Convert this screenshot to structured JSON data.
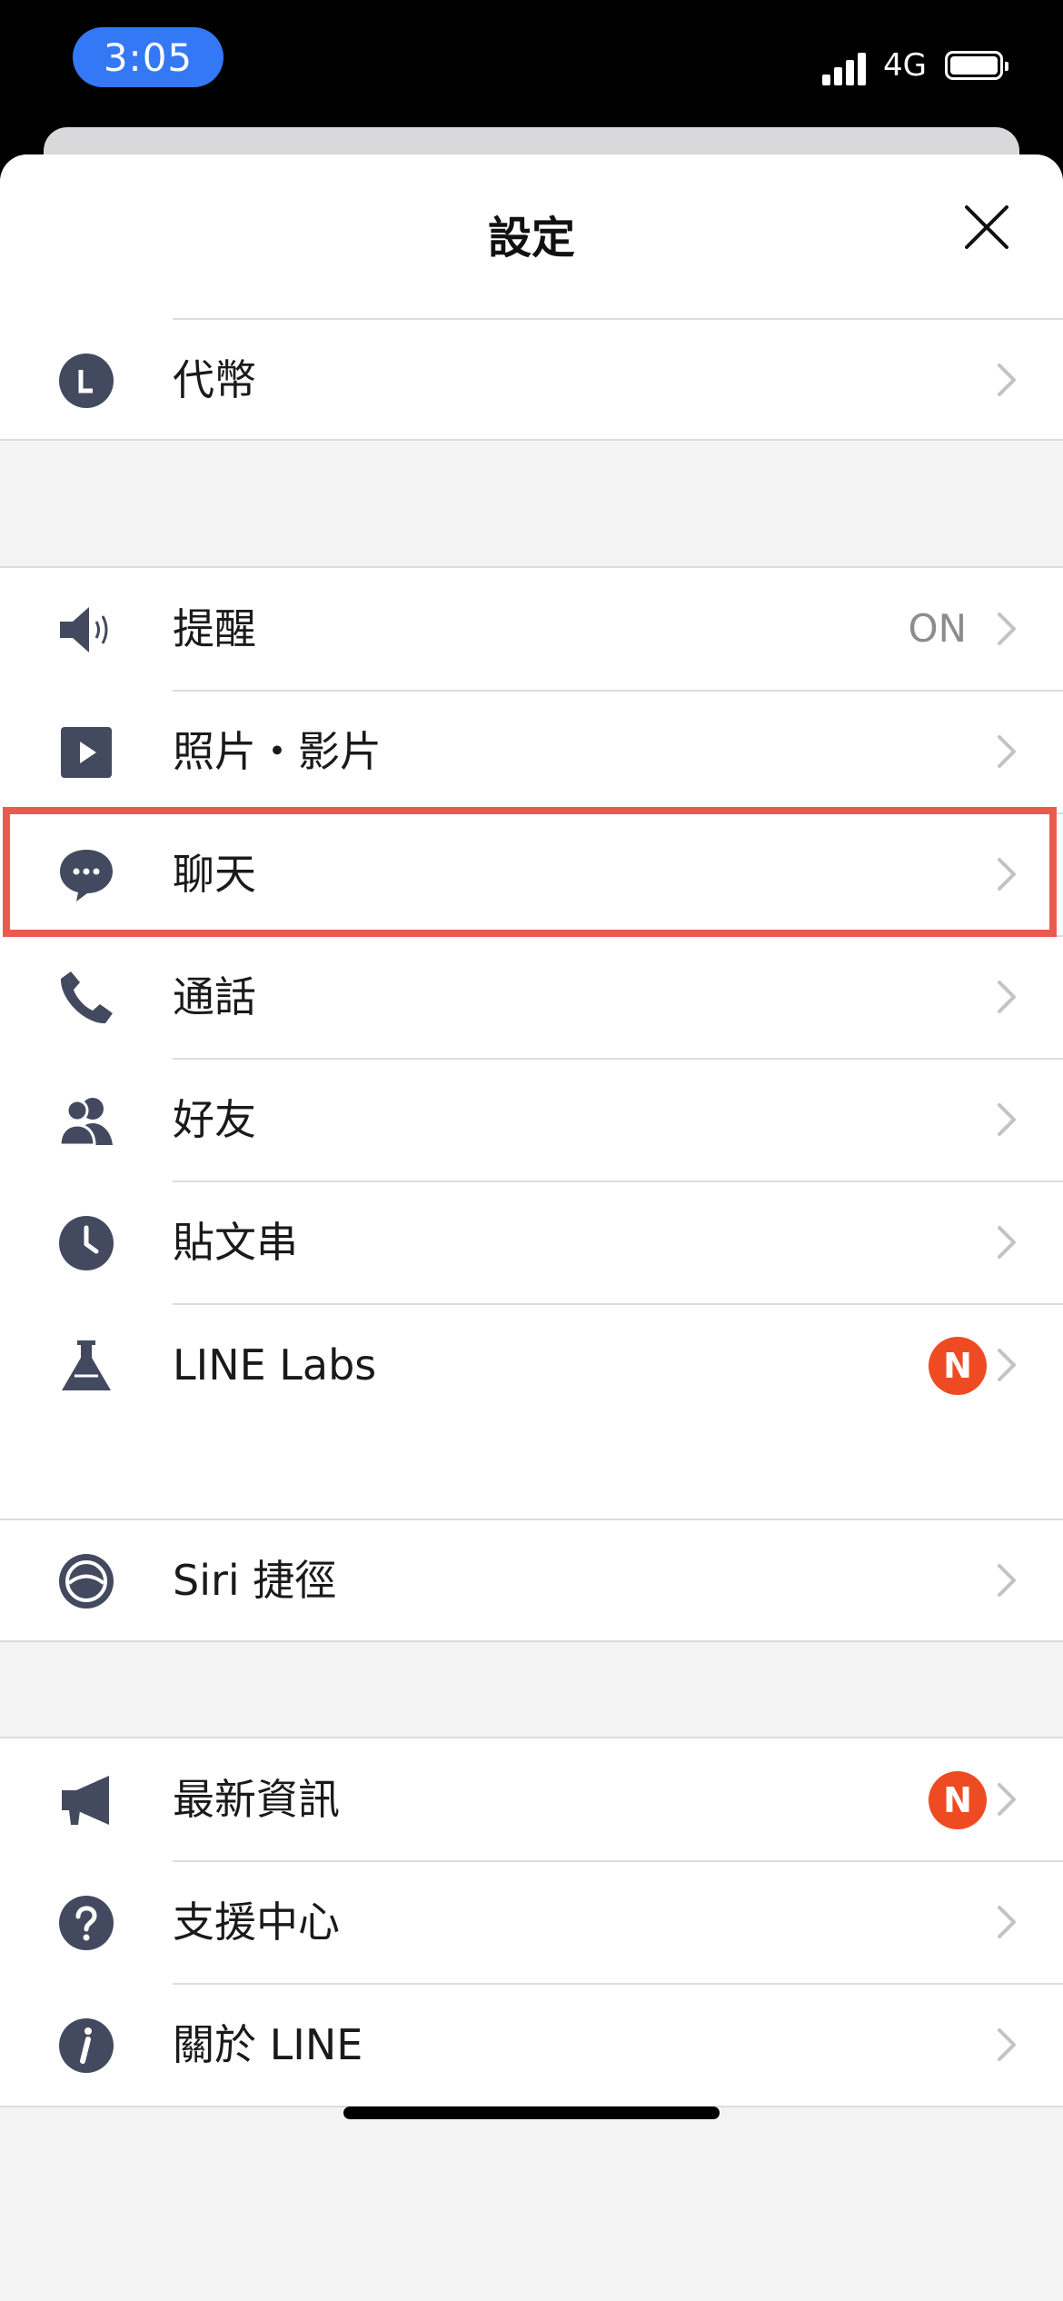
{
  "status_bar": {
    "time": "3:05",
    "network": "4G"
  },
  "sheet": {
    "title": "設定"
  },
  "sections": {
    "top": [
      {
        "label": "代幣",
        "icon": "line-coin-icon"
      }
    ],
    "main": [
      {
        "label": "提醒",
        "icon": "speaker-icon",
        "value": "ON"
      },
      {
        "label": "照片・影片",
        "icon": "play-icon"
      },
      {
        "label": "聊天",
        "icon": "chat-bubble-icon"
      },
      {
        "label": "通話",
        "icon": "phone-icon"
      },
      {
        "label": "好友",
        "icon": "friends-icon"
      },
      {
        "label": "貼文串",
        "icon": "clock-icon"
      },
      {
        "label": "LINE Labs",
        "icon": "flask-icon",
        "badge": "N"
      }
    ],
    "siri": [
      {
        "label": "Siri 捷徑",
        "icon": "siri-icon"
      }
    ],
    "info": [
      {
        "label": "最新資訊",
        "icon": "megaphone-icon",
        "badge": "N"
      },
      {
        "label": "支援中心",
        "icon": "help-icon"
      },
      {
        "label": "關於 LINE",
        "icon": "info-icon"
      }
    ]
  },
  "colors": {
    "icon": "#434a5f",
    "badge": "#ef4b22",
    "highlight": "#ea5b4f",
    "time_pill": "#3478f6"
  }
}
